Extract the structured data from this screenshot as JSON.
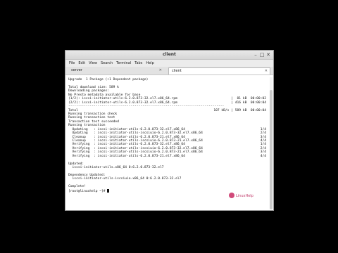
{
  "window": {
    "title": "client",
    "minimize_glyph": "–",
    "maximize_glyph": "□",
    "close_glyph": "✕"
  },
  "menu": [
    "File",
    "Edit",
    "View",
    "Search",
    "Terminal",
    "Tabs",
    "Help"
  ],
  "tabs": [
    {
      "label": "server",
      "active": false
    },
    {
      "label": "client",
      "active": true
    }
  ],
  "tab_close_glyph": "✕",
  "terminal": {
    "lines": [
      "Upgrade  1 Package (+1 Dependent package)",
      "",
      "Total download size: 589 k",
      "Downloading packages:",
      "No Presto metadata available for base",
      [
        "(1/2): iscsi-initiator-utils-6.2.0.873-32.el7.x86_64.rpm",
        "|  81 kB  00:00:02"
      ],
      [
        "(2/2): iscsi-initiator-utils-6.2.0.873-32.el7.x86_64.rpm",
        "| 416 kB  00:00:04"
      ],
      "--------------------------------------------------------------------------------",
      [
        "Total",
        "107 kB/s | 589 kB  00:00:04"
      ],
      "Running transaction check",
      "Running transaction test",
      "Transaction test succeeded",
      "Running transaction",
      [
        "  Updating   : iscsi-initiator-utils-6.2.0.873-32.el7.x86_64",
        "1/4"
      ],
      [
        "  Updating   : iscsi-initiator-utils-iscsiuio-6.2.0.873-32.el7.x86_64",
        "2/4"
      ],
      [
        "  Cleanup    : iscsi-initiator-utils-6.2.0.873-21.el7.x86_64",
        "3/4"
      ],
      [
        "  Cleanup    : iscsi-initiator-utils-iscsiuio-6.2.0.873-21.el7.x86_64",
        "4/4"
      ],
      [
        "  Verifying  : iscsi-initiator-utils-6.2.0.873-32.el7.x86_64",
        "1/4"
      ],
      [
        "  Verifying  : iscsi-initiator-utils-iscsiuio-6.2.0.873-32.el7.x86_64",
        "2/4"
      ],
      [
        "  Verifying  : iscsi-initiator-utils-iscsiuio-6.2.0.873-21.el7.x86_64",
        "3/4"
      ],
      [
        "  Verifying  : iscsi-initiator-utils-6.2.0.873-21.el7.x86_64",
        "4/4"
      ],
      "",
      "Updated:",
      "  iscsi-initiator-utils.x86_64 0:6.2.0.873-32.el7",
      "",
      "Dependency Updated:",
      "  iscsi-initiator-utils-iscsiuio.x86_64 0:6.2.0.873-32.el7",
      "",
      "Complete!"
    ],
    "prompt": "[root@linuxhelp ~]# "
  },
  "watermark": {
    "text": "LinuxHelp"
  },
  "colors": {
    "background": "#000000",
    "terminal_bg": "#ffffff",
    "text": "#111111",
    "accent": "#c0396a"
  }
}
